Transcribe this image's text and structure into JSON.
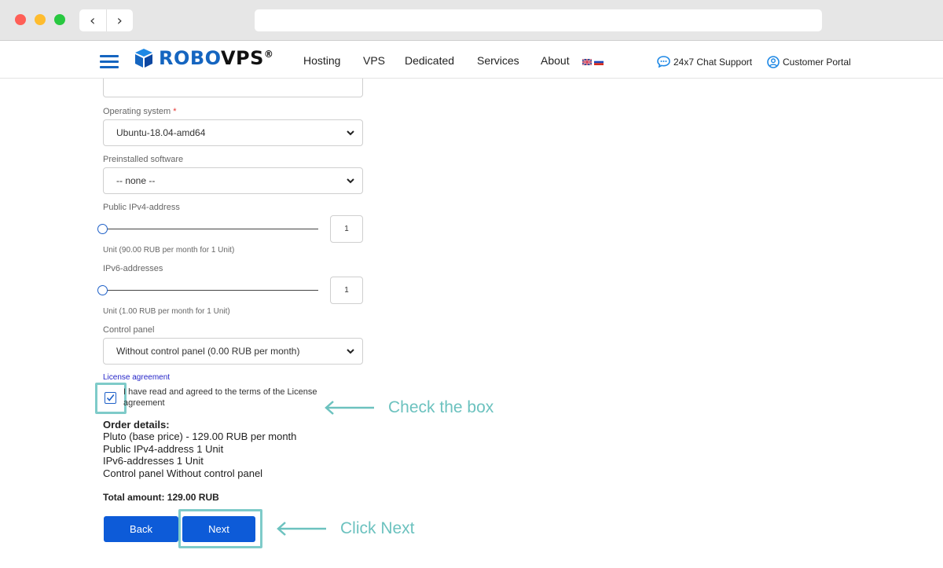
{
  "header": {
    "logo": {
      "part1": "ROBO",
      "part2": "VPS",
      "mark": "®"
    },
    "nav": [
      "Hosting",
      "VPS",
      "Dedicated",
      "Services",
      "About"
    ],
    "chat_support": "24x7 Chat Support",
    "customer_portal": "Customer Portal"
  },
  "form": {
    "os": {
      "label": "Operating system",
      "required": "*",
      "value": "Ubuntu-18.04-amd64"
    },
    "software": {
      "label": "Preinstalled software",
      "value": "-- none --"
    },
    "ipv4": {
      "label": "Public IPv4-address",
      "qty": "1",
      "note": "Unit (90.00 RUB per month for 1 Unit)",
      "slider_fraction": 0
    },
    "ipv6": {
      "label": "IPv6-addresses",
      "qty": "1",
      "note": "Unit (1.00 RUB per month for 1 Unit)",
      "slider_fraction": 0
    },
    "control_panel": {
      "label": "Control panel",
      "value": "Without control panel (0.00 RUB per month)"
    },
    "license": {
      "link": "License agreement",
      "text": "I have read and agreed to the terms of the License agreement",
      "checked": true
    }
  },
  "order": {
    "title": "Order details:",
    "lines": [
      "Pluto (base price) - 129.00 RUB per month",
      "Public IPv4-address 1 Unit",
      "IPv6-addresses 1 Unit",
      "Control panel Without control panel"
    ],
    "total": "Total amount: 129.00 RUB"
  },
  "buttons": {
    "back": "Back",
    "next": "Next"
  },
  "annotations": {
    "check": "Check the box",
    "next": "Click Next"
  },
  "colors": {
    "brand": "#1565c0",
    "button": "#0d5bd8",
    "annotation": "#6cc2bf"
  }
}
